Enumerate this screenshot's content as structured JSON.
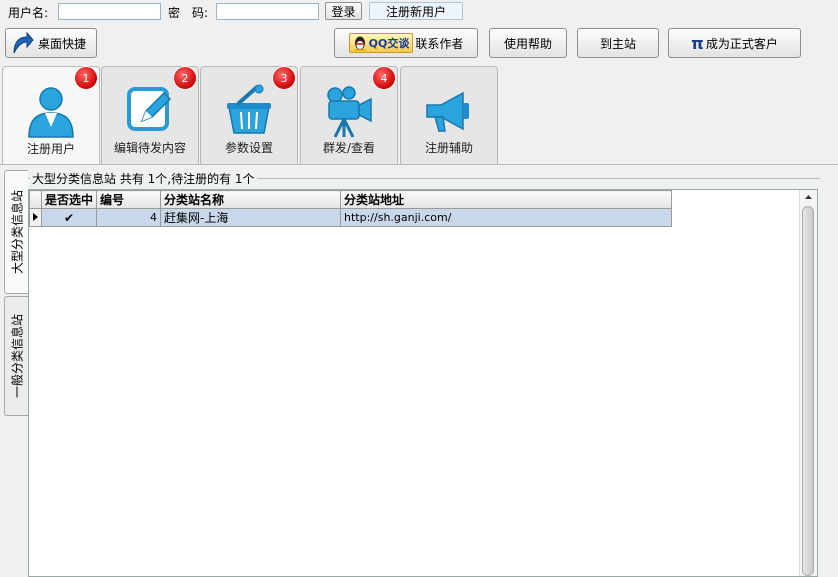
{
  "login": {
    "username_label": "用户名:",
    "password_label": "密　码:",
    "username_value": "",
    "password_value": "",
    "login_button": "登录",
    "register_button": "注册新用户"
  },
  "toolbar": {
    "desktop_shortcut": "桌面快捷",
    "qq_chat": "QQ交谈",
    "contact_author": "联系作者",
    "help": "使用帮助",
    "home": "到主站",
    "become_customer_symbol": "π",
    "become_customer": "成为正式客户"
  },
  "tabs": [
    {
      "label": "注册用户",
      "badge": "1",
      "icon": "user-icon"
    },
    {
      "label": "编辑待发内容",
      "badge": "2",
      "icon": "edit-icon"
    },
    {
      "label": "参数设置",
      "badge": "3",
      "icon": "basket-settings-icon"
    },
    {
      "label": "群发/查看",
      "badge": "4",
      "icon": "camera-icon"
    },
    {
      "label": "注册辅助",
      "badge": "",
      "icon": "megaphone-icon"
    }
  ],
  "side_tabs": [
    "大型分类信息站",
    "一般分类信息站"
  ],
  "group": {
    "caption": "大型分类信息站 共有 1个,待注册的有 1个"
  },
  "grid": {
    "columns": [
      "是否选中",
      "编号",
      "分类站名称",
      "分类站地址"
    ],
    "rows": [
      {
        "selected": "✔",
        "id": "4",
        "name": "赶集网-上海",
        "url": "http://sh.ganji.com/"
      }
    ]
  }
}
